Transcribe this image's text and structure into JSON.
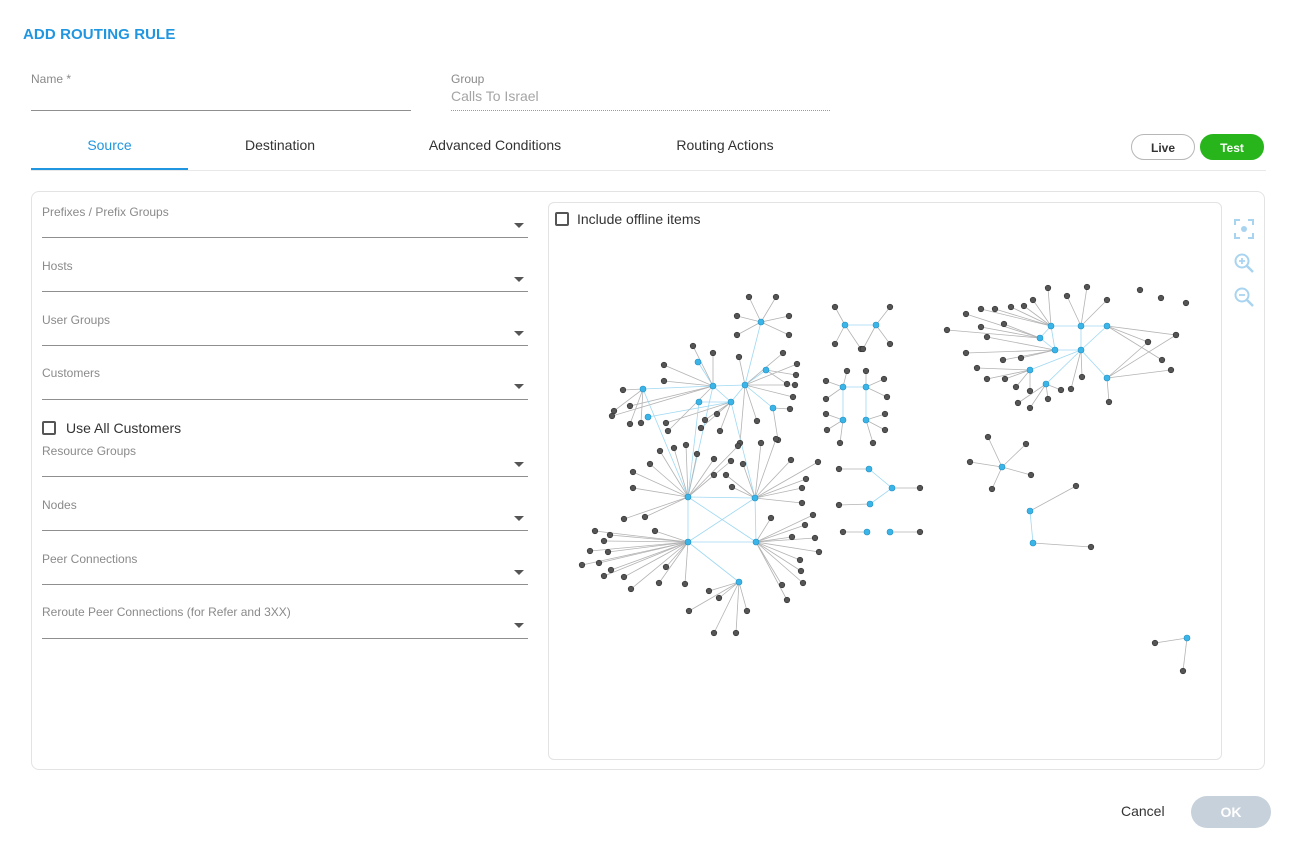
{
  "dialog": {
    "title": "ADD ROUTING RULE"
  },
  "form": {
    "name_label": "Name *",
    "name_value": "",
    "group_label": "Group",
    "group_value": "Calls To Israel"
  },
  "tabs": [
    {
      "label": "Source",
      "active": true
    },
    {
      "label": "Destination",
      "active": false
    },
    {
      "label": "Advanced Conditions",
      "active": false
    },
    {
      "label": "Routing Actions",
      "active": false
    }
  ],
  "mode": {
    "live_label": "Live",
    "test_label": "Test",
    "selected": "Test"
  },
  "source": {
    "prefixes_label": "Prefixes / Prefix Groups",
    "hosts_label": "Hosts",
    "user_groups_label": "User Groups",
    "customers_label": "Customers",
    "use_all_customers_label": "Use All Customers",
    "use_all_customers_checked": false,
    "resource_groups_label": "Resource Groups",
    "nodes_label": "Nodes",
    "peer_connections_label": "Peer Connections",
    "reroute_label": "Reroute Peer Connections (for Refer and 3XX)"
  },
  "graph": {
    "include_offline_label": "Include offline items",
    "include_offline_checked": false,
    "tools": [
      "fit-view-icon",
      "zoom-in-icon",
      "zoom-out-icon"
    ],
    "colors": {
      "hub": "#3bb5e8",
      "leaf": "#555555",
      "edge": "#b3b3b3",
      "hub_edge": "#9fd8f2"
    }
  },
  "footer": {
    "cancel_label": "Cancel",
    "ok_label": "OK"
  },
  "colors": {
    "accent": "#2196e0",
    "test_green": "#28b51c",
    "ok_disabled": "#c7d1db"
  }
}
